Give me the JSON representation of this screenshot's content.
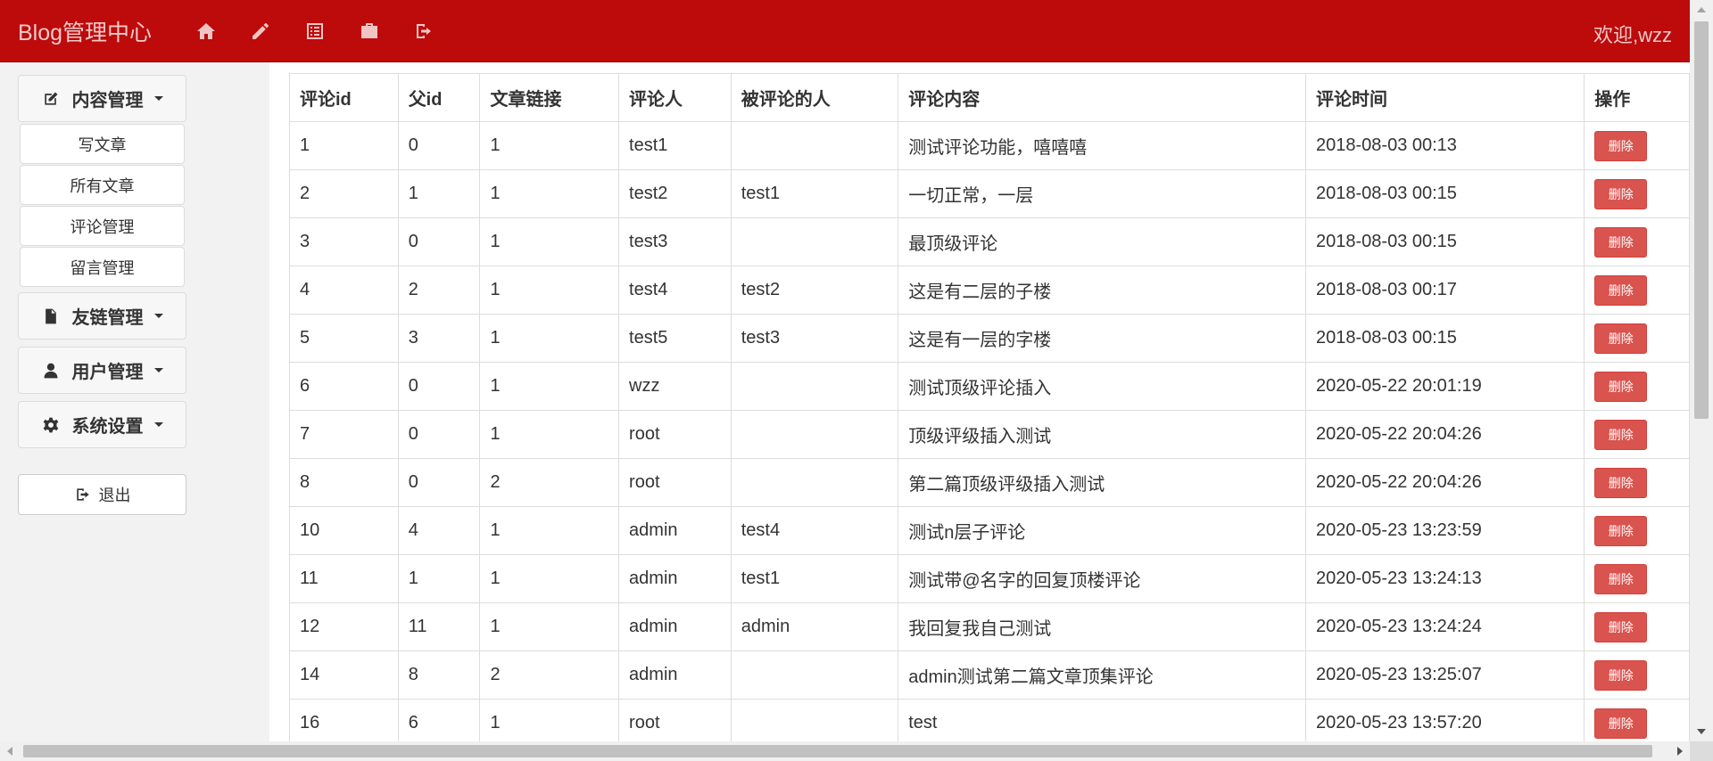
{
  "navbar": {
    "brand": "Blog管理中心",
    "icons": [
      "home-icon",
      "pencil-icon",
      "list-icon",
      "briefcase-icon",
      "logout-icon"
    ],
    "welcome": "欢迎,wzz",
    "color": "#bd0a0a"
  },
  "sidebar": {
    "groups": [
      {
        "label": "内容管理",
        "icon": "edit-icon"
      },
      {
        "label": "友链管理",
        "icon": "file-icon"
      },
      {
        "label": "用户管理",
        "icon": "user-icon"
      },
      {
        "label": "系统设置",
        "icon": "gear-icon"
      }
    ],
    "content_items": [
      "写文章",
      "所有文章",
      "评论管理",
      "留言管理"
    ],
    "logout_label": "退出"
  },
  "table": {
    "headers": [
      "评论id",
      "父id",
      "文章链接",
      "评论人",
      "被评论的人",
      "评论内容",
      "评论时间",
      "操作"
    ],
    "delete_label": "删除",
    "delete_color": "#d9534f",
    "rows": [
      [
        "1",
        "0",
        "1",
        "test1",
        "",
        "测试评论功能，嘻嘻嘻",
        "2018-08-03 00:13"
      ],
      [
        "2",
        "1",
        "1",
        "test2",
        "test1",
        "一切正常，一层",
        "2018-08-03 00:15"
      ],
      [
        "3",
        "0",
        "1",
        "test3",
        "",
        "最顶级评论",
        "2018-08-03 00:15"
      ],
      [
        "4",
        "2",
        "1",
        "test4",
        "test2",
        "这是有二层的子楼",
        "2018-08-03 00:17"
      ],
      [
        "5",
        "3",
        "1",
        "test5",
        "test3",
        "这是有一层的字楼",
        "2018-08-03 00:15"
      ],
      [
        "6",
        "0",
        "1",
        "wzz",
        "",
        "测试顶级评论插入",
        "2020-05-22 20:01:19"
      ],
      [
        "7",
        "0",
        "1",
        "root",
        "",
        "顶级评级插入测试",
        "2020-05-22 20:04:26"
      ],
      [
        "8",
        "0",
        "2",
        "root",
        "",
        "第二篇顶级评级插入测试",
        "2020-05-22 20:04:26"
      ],
      [
        "10",
        "4",
        "1",
        "admin",
        "test4",
        "测试n层子评论",
        "2020-05-23 13:23:59"
      ],
      [
        "11",
        "1",
        "1",
        "admin",
        "test1",
        "测试带@名字的回复顶楼评论",
        "2020-05-23 13:24:13"
      ],
      [
        "12",
        "11",
        "1",
        "admin",
        "admin",
        "我回复我自己测试",
        "2020-05-23 13:24:24"
      ],
      [
        "14",
        "8",
        "2",
        "admin",
        "",
        "admin测试第二篇文章顶集评论",
        "2020-05-23 13:25:07"
      ],
      [
        "16",
        "6",
        "1",
        "root",
        "",
        "test",
        "2020-05-23 13:57:20"
      ]
    ]
  }
}
